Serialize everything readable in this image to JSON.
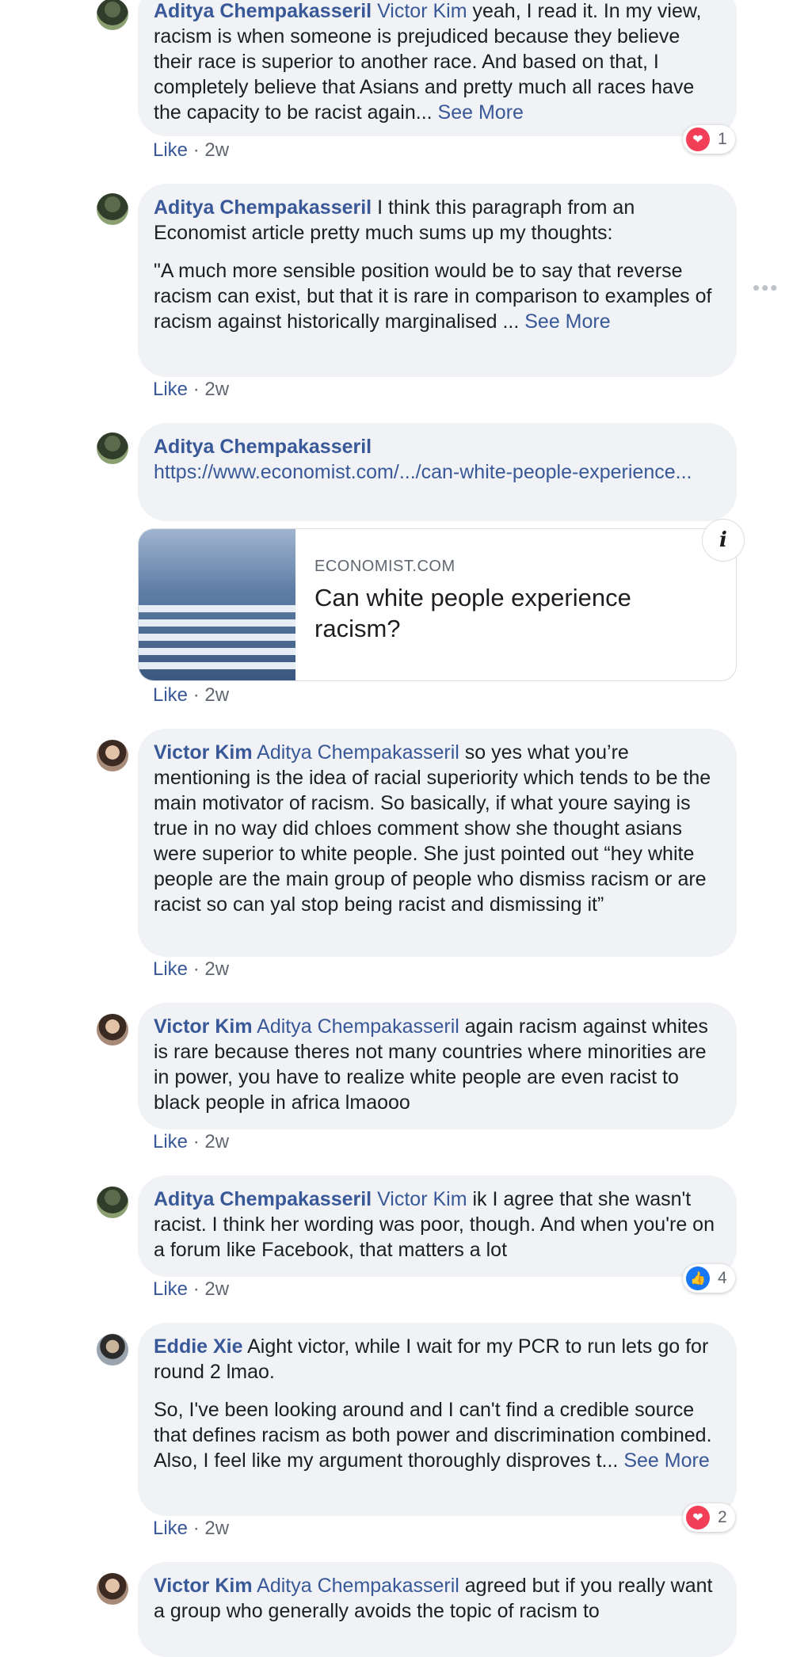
{
  "comments": [
    {
      "author": "Aditya Chempakasseril",
      "mention": "Victor Kim",
      "text": " yeah, I read it. In my view, racism is when someone is prejudiced because they believe their race is superior to another race. And based on that, I completely believe that Asians and pretty much all races have the capacity to be racist again...",
      "see_more": "See More",
      "like": "Like",
      "time": "2w",
      "reaction_count": "1",
      "reaction_icon": "heart-icon"
    },
    {
      "author": "Aditya Chempakasseril",
      "text": " I think this paragraph from an Economist article pretty much sums up my thoughts:",
      "text2": "\"A much more sensible position would be to say that reverse racism can exist, but that it is rare in comparison to examples of racism against historically marginalised ...",
      "see_more": "See More",
      "more_options": "•••",
      "like": "Like",
      "time": "2w"
    },
    {
      "author": "Aditya Chempakasseril",
      "link": "https://www.economist.com/.../can-white-people-experience...",
      "preview_source": "ECONOMIST.COM",
      "preview_title": "Can white people experience racism?",
      "info": "i",
      "like": "Like",
      "time": "2w"
    },
    {
      "author": "Victor Kim",
      "mention": "Aditya Chempakasseril",
      "text": " so yes what you’re mentioning is the idea of racial superiority which tends to be the main motivator of racism. So basically, if what youre saying is true in no way did chloes comment show she thought asians were superior to white people. She just pointed out “hey white people are the main group of people who dismiss racism or are racist so can yal stop being racist and dismissing it”",
      "like": "Like",
      "time": "2w"
    },
    {
      "author": "Victor Kim",
      "mention": "Aditya Chempakasseril",
      "text": " again racism against whites is rare because theres not many countries where minorities are in power, you have to realize white people are even racist to black people in africa lmaooo",
      "like": "Like",
      "time": "2w"
    },
    {
      "author": "Aditya Chempakasseril",
      "mention": "Victor Kim",
      "text": " ik I agree that she wasn't racist. I think her wording was poor, though. And when you're on a forum like Facebook, that matters a lot",
      "like": "Like",
      "time": "2w",
      "reaction_count": "4",
      "reaction_icon": "thumbs-up-icon"
    },
    {
      "author": "Eddie Xie",
      "text": " Aight victor, while I wait for my PCR to run lets go for round 2 lmao.",
      "text2": "So, I've been looking around and I can't find a credible source that defines racism as both power and discrimination combined. Also, I feel like my argument thoroughly disproves t...",
      "see_more": "See More",
      "like": "Like",
      "time": "2w",
      "reaction_count": "2",
      "reaction_icon": "heart-icon"
    },
    {
      "author": "Victor Kim",
      "mention": "Aditya Chempakasseril",
      "text": " agreed but if you really want a group who generally avoids the topic of racism to"
    }
  ],
  "separator": " · "
}
